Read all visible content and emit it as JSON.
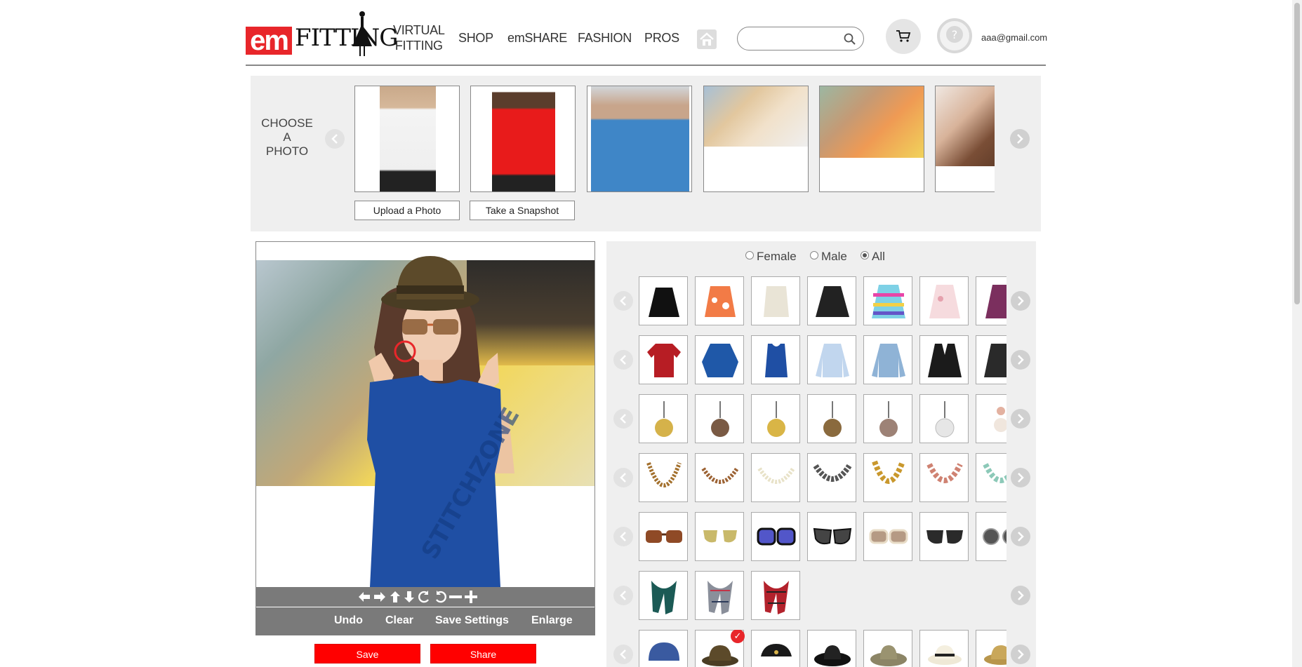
{
  "header": {
    "logo_em": "em",
    "logo_fitting": "FITTING",
    "nav": [
      {
        "id": "virtual",
        "line1": "VIRTUAL",
        "line2": "FITTING"
      },
      {
        "id": "shop",
        "label": "SHOP"
      },
      {
        "id": "emshare",
        "label": "emSHARE"
      },
      {
        "id": "fashion",
        "label": "FASHION"
      },
      {
        "id": "pros",
        "label": "PROS"
      }
    ],
    "search_placeholder": "",
    "user_email": "aaa@gmail.com"
  },
  "choose_photo": {
    "label_line1": "CHOOSE",
    "label_line2": "A",
    "label_line3": "PHOTO",
    "upload_label": "Upload a Photo",
    "snapshot_label": "Take a Snapshot"
  },
  "editor": {
    "undo_label": "Undo",
    "clear_label": "Clear",
    "save_settings_label": "Save Settings",
    "enlarge_label": "Enlarge",
    "watermark": "STITCHZONE",
    "save_label": "Save",
    "share_label": "Share"
  },
  "catalog": {
    "gender_options": [
      "Female",
      "Male",
      "All"
    ],
    "gender_selected": "All",
    "rows": [
      "skirts",
      "tops",
      "earrings",
      "necklaces",
      "sunglasses",
      "scarves",
      "hats"
    ]
  },
  "colors": {
    "brand_red": "#e8262a",
    "button_red": "#ff0000",
    "panel_gray": "#efefef",
    "toolbar_gray": "#7a7a7a"
  }
}
